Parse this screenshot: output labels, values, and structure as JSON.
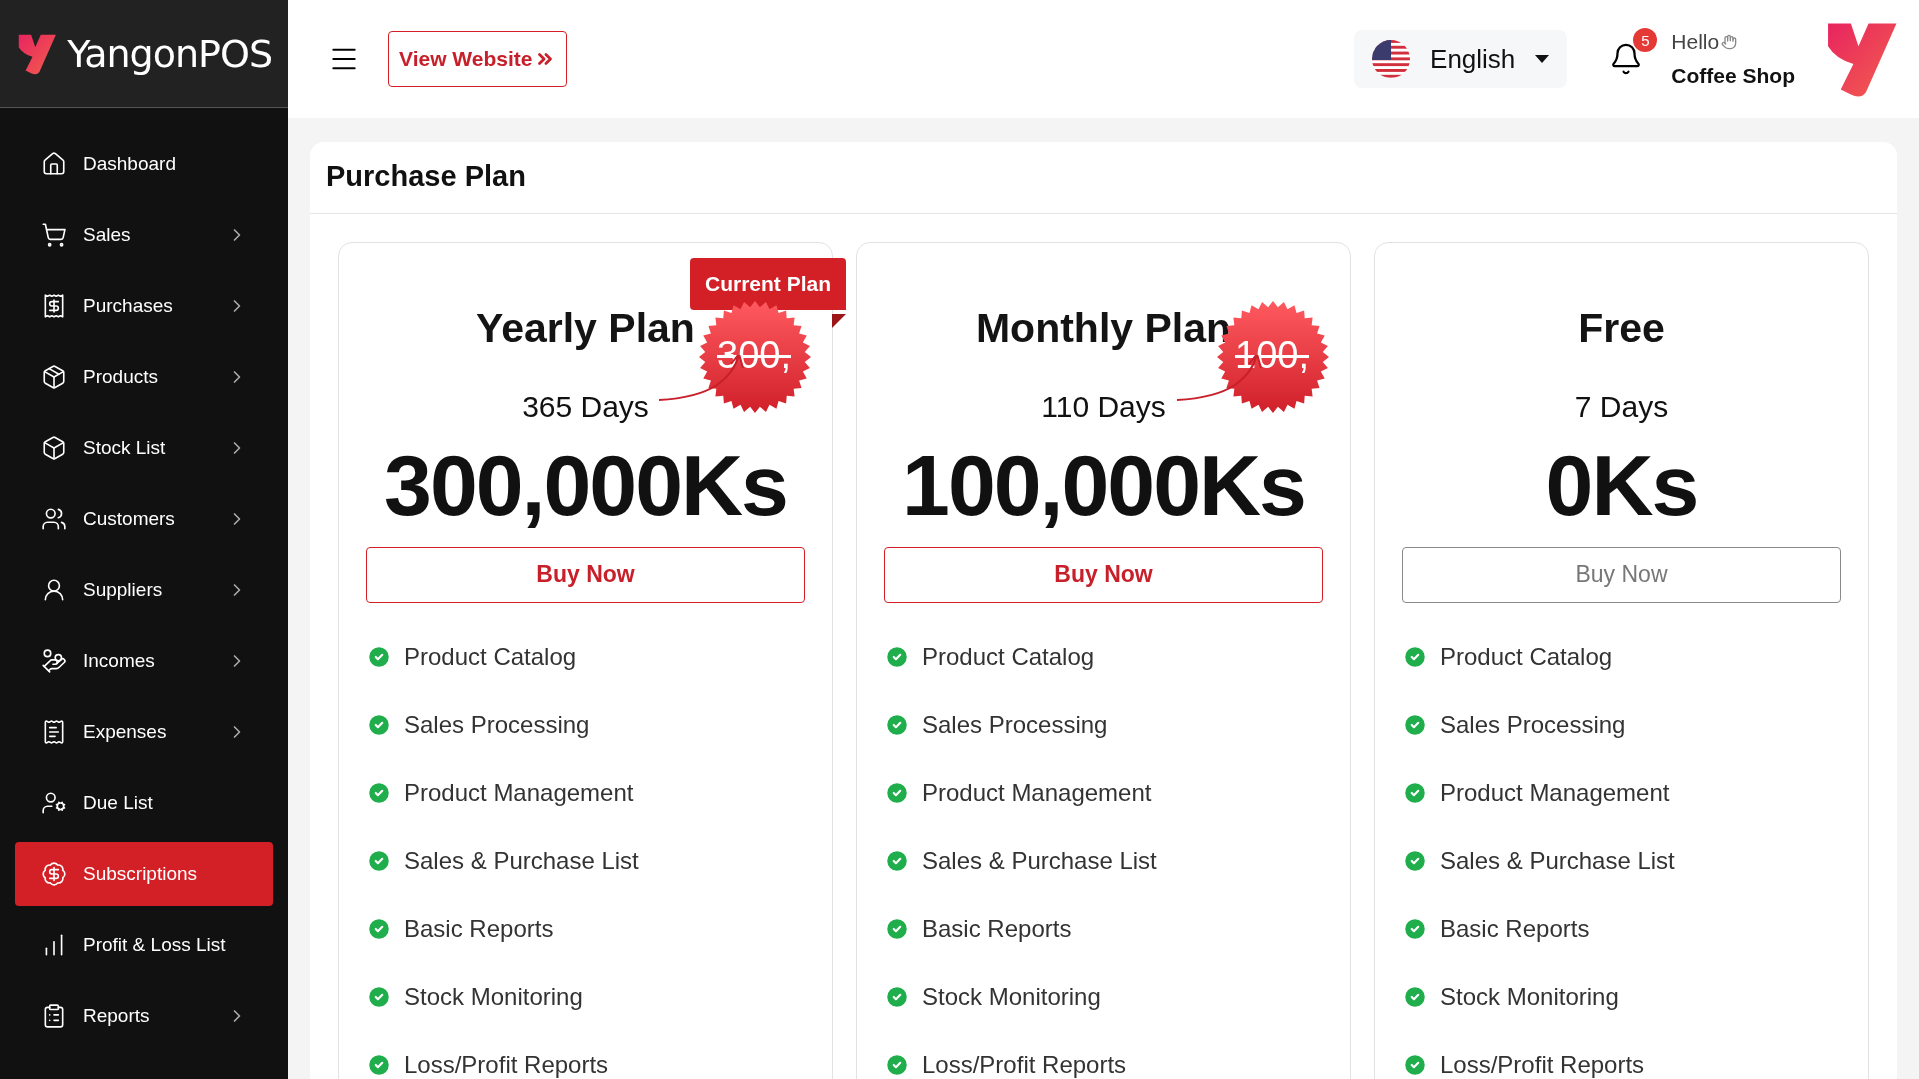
{
  "brand": {
    "name": "YangonPOS"
  },
  "header": {
    "view_website": "View Website",
    "language": "English",
    "notifications": "5",
    "greeting": "Hello",
    "user": "Coffee Shop"
  },
  "sidebar": {
    "items": [
      {
        "label": "Dashboard",
        "expandable": false,
        "selected": false
      },
      {
        "label": "Sales",
        "expandable": true,
        "selected": false
      },
      {
        "label": "Purchases",
        "expandable": true,
        "selected": false
      },
      {
        "label": "Products",
        "expandable": true,
        "selected": false
      },
      {
        "label": "Stock List",
        "expandable": true,
        "selected": false
      },
      {
        "label": "Customers",
        "expandable": true,
        "selected": false
      },
      {
        "label": "Suppliers",
        "expandable": true,
        "selected": false
      },
      {
        "label": "Incomes",
        "expandable": true,
        "selected": false
      },
      {
        "label": "Expenses",
        "expandable": true,
        "selected": false
      },
      {
        "label": "Due List",
        "expandable": false,
        "selected": false
      },
      {
        "label": "Subscriptions",
        "expandable": false,
        "selected": true
      },
      {
        "label": "Profit & Loss List",
        "expandable": false,
        "selected": false
      },
      {
        "label": "Reports",
        "expandable": true,
        "selected": false
      }
    ]
  },
  "page": {
    "title": "Purchase Plan"
  },
  "plans": [
    {
      "name": "Yearly Plan",
      "ribbon": "Current Plan",
      "old_price": "300,",
      "days": "365 Days",
      "price": "300,000Ks",
      "button": "Buy Now",
      "disabled": false,
      "features": [
        "Product Catalog",
        "Sales Processing",
        "Product Management",
        "Sales & Purchase List",
        "Basic Reports",
        "Stock Monitoring",
        "Loss/Profit Reports"
      ]
    },
    {
      "name": "Monthly Plan",
      "old_price": "100,",
      "days": "110 Days",
      "price": "100,000Ks",
      "button": "Buy Now",
      "disabled": false,
      "features": [
        "Product Catalog",
        "Sales Processing",
        "Product Management",
        "Sales & Purchase List",
        "Basic Reports",
        "Stock Monitoring",
        "Loss/Profit Reports"
      ]
    },
    {
      "name": "Free",
      "days": "7 Days",
      "price": "0Ks",
      "button": "Buy Now",
      "disabled": true,
      "features": [
        "Product Catalog",
        "Sales Processing",
        "Product Management",
        "Sales & Purchase List",
        "Basic Reports",
        "Stock Monitoring",
        "Loss/Profit Reports"
      ]
    }
  ]
}
